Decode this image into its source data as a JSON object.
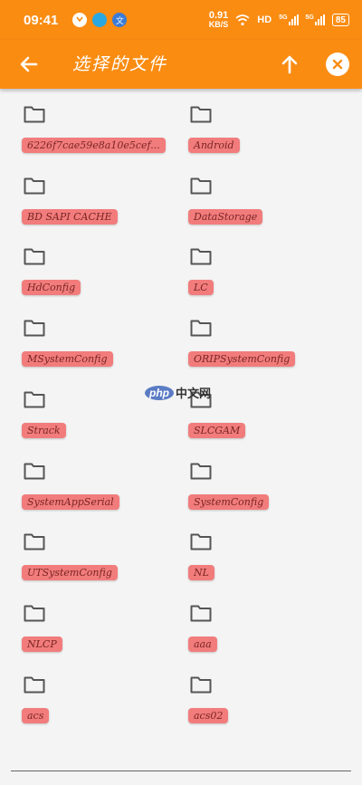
{
  "status_bar": {
    "time": "09:41",
    "net_speed_value": "0.91",
    "net_speed_unit": "KB/S",
    "hd_label": "HD",
    "signal1": "5G",
    "signal2": "5G",
    "battery": "85"
  },
  "app_bar": {
    "title": "选择的文件"
  },
  "folders": [
    "6226f7cae59e8a10e5cef...",
    "Android",
    "BD SAPI CACHE",
    "DataStorage",
    "HdConfig",
    "LC",
    "MSystemConfig",
    "ORIPSystemConfig",
    "Strack",
    "SLCGAM",
    "SystemAppSerial",
    "SystemConfig",
    "UTSystemConfig",
    "NL",
    "NLCP",
    "aaa",
    "acs",
    "acs02"
  ],
  "watermark": {
    "logo": "php",
    "text": "中文网"
  },
  "colors": {
    "accent": "#fa8c12",
    "label_bg": "#f27c7c"
  }
}
